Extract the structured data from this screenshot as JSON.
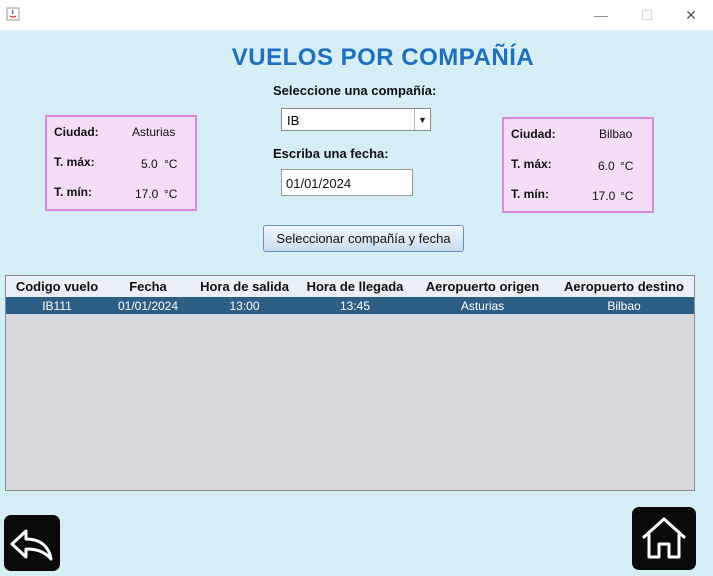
{
  "window": {
    "minimize": "—",
    "maximize": "☐",
    "close": "✕"
  },
  "title": "VUELOS POR COMPAÑÍA",
  "form": {
    "company_label": "Seleccione una compañía:",
    "company_value": "IB",
    "date_label": "Escriba una fecha:",
    "date_value": "01/01/2024",
    "submit_label": "Seleccionar compañía y fecha"
  },
  "weather_left": {
    "city_label": "Ciudad:",
    "city": "Asturias",
    "max_label": "T. máx:",
    "max": "5.0",
    "max_unit": "°C",
    "min_label": "T. mín:",
    "min": "17.0",
    "min_unit": "°C"
  },
  "weather_right": {
    "city_label": "Ciudad:",
    "city": "Bilbao",
    "max_label": "T. máx:",
    "max": "6.0",
    "max_unit": "°C",
    "min_label": "T. mín:",
    "min": "17.0",
    "min_unit": "°C"
  },
  "table": {
    "headers": [
      "Codigo vuelo",
      "Fecha",
      "Hora de salida",
      "Hora de llegada",
      "Aeropuerto origen",
      "Aeropuerto destino"
    ],
    "rows": [
      [
        "IB111",
        "01/01/2024",
        "13:00",
        "13:45",
        "Asturias",
        "Bilbao"
      ]
    ]
  },
  "icons": {
    "back": "back-arrow-icon",
    "home": "home-icon",
    "app": "java-icon"
  },
  "colors": {
    "background": "#d6eef5",
    "title": "#1f6fbf",
    "selected_row": "#2d5f86",
    "panel": "#f5ddf5",
    "panel_border": "#d98ad9"
  }
}
